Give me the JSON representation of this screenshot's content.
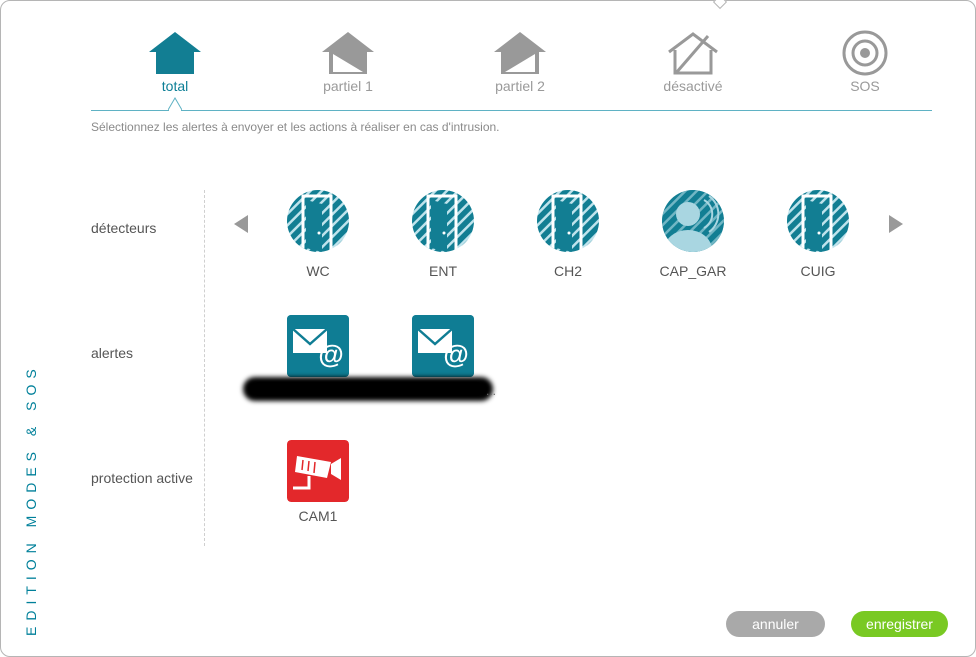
{
  "side_title": "EDITION MODES & SOS",
  "modes": [
    {
      "label": "total",
      "icon": "house-filled-icon",
      "active": true
    },
    {
      "label": "partiel 1",
      "icon": "house-partial-icon",
      "active": false
    },
    {
      "label": "partiel 2",
      "icon": "house-partial-icon",
      "active": false
    },
    {
      "label": "désactivé",
      "icon": "house-outline-icon",
      "active": false
    },
    {
      "label": "SOS",
      "icon": "target-icon",
      "active": false
    }
  ],
  "instruction": "Sélectionnez les alertes à envoyer et les actions à réaliser en cas d'intrusion.",
  "rows": {
    "detectors": "détecteurs",
    "alerts": "alertes",
    "protection": "protection active"
  },
  "detectors": [
    {
      "label": "WC",
      "icon": "door-sensor-icon"
    },
    {
      "label": "ENT",
      "icon": "door-sensor-icon"
    },
    {
      "label": "CH2",
      "icon": "door-sensor-icon"
    },
    {
      "label": "CAP_GAR",
      "icon": "motion-sensor-icon"
    },
    {
      "label": "CUIG",
      "icon": "door-sensor-icon"
    }
  ],
  "alerts": [
    {
      "icon": "email-icon"
    },
    {
      "icon": "email-icon"
    }
  ],
  "alert_ellipsis": "...",
  "protection": [
    {
      "label": "CAM1",
      "icon": "camera-icon"
    }
  ],
  "buttons": {
    "cancel": "annuler",
    "save": "enregistrer"
  },
  "colors": {
    "accent": "#00809a",
    "teal": "#127e93",
    "inactive": "#9a9a9a",
    "camera_red": "#e3282b",
    "save_green": "#79c923",
    "cancel_gray": "#a9a9a9"
  }
}
